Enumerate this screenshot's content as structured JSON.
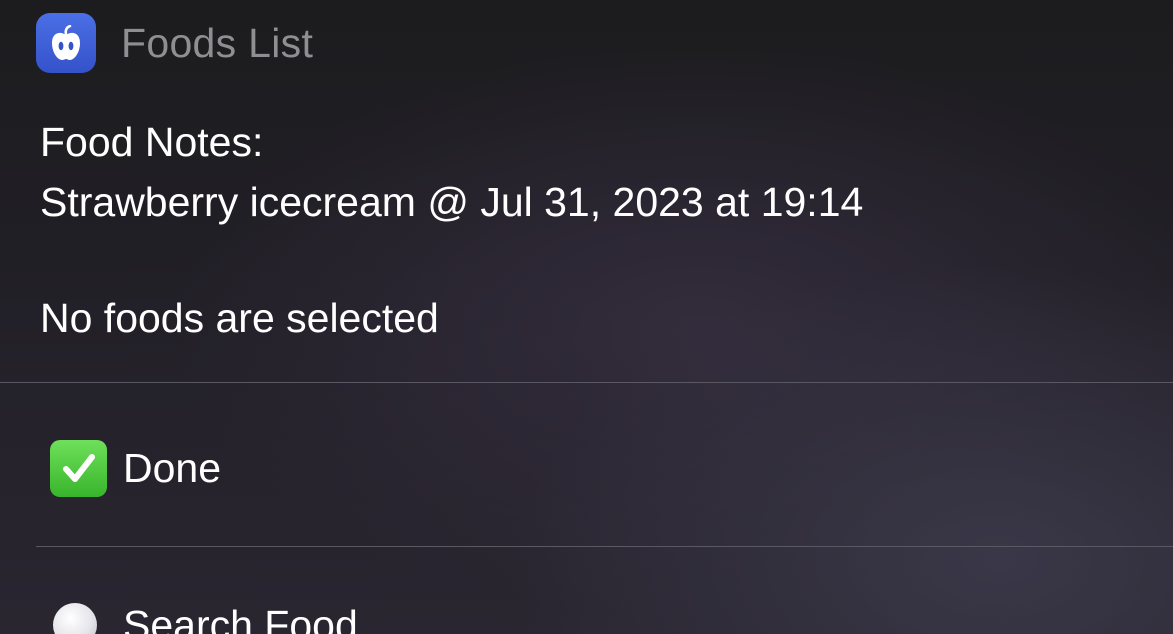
{
  "header": {
    "app_icon": "apple-icon",
    "title": "Foods List"
  },
  "notes": {
    "line1": "Food Notes:",
    "line2": "Strawberry icecream @ Jul 31, 2023 at 19:14"
  },
  "status": "No foods are selected",
  "options": [
    {
      "label": "Done",
      "icon": "checkmark-icon",
      "icon_color": "#3cc22f"
    },
    {
      "label": "Search Food",
      "icon": "radio-icon"
    }
  ],
  "colors": {
    "app_icon_bg": "#3f5fd8",
    "title_gray": "#8e8e93",
    "divider": "#5a5862"
  }
}
